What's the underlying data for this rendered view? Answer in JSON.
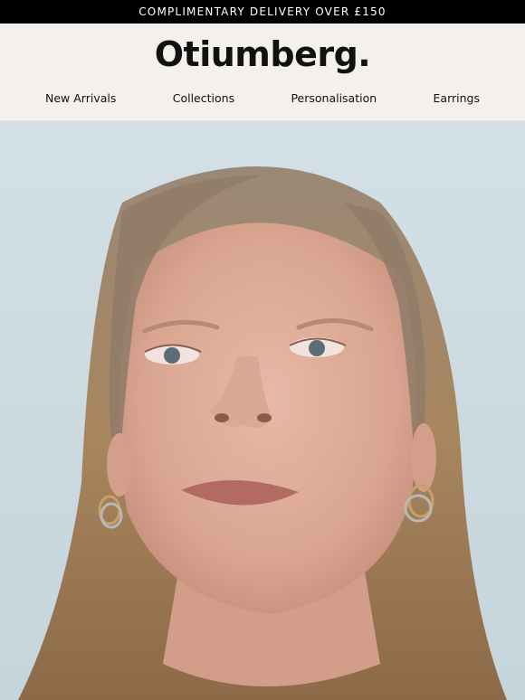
{
  "announcement": {
    "text": "COMPLIMENTARY DELIVERY OVER £150"
  },
  "brand": {
    "logo_text": "Otiumberg."
  },
  "nav": {
    "items": [
      {
        "label": "New Arrivals"
      },
      {
        "label": "Collections"
      },
      {
        "label": "Personalisation"
      },
      {
        "label": "Earrings"
      }
    ]
  },
  "hero": {
    "image": "portrait-woman-hoop-earrings"
  },
  "colors": {
    "announcement_bg": "#000000",
    "header_bg": "#f4f0ec",
    "hero_bg": "#d4e0e6"
  }
}
